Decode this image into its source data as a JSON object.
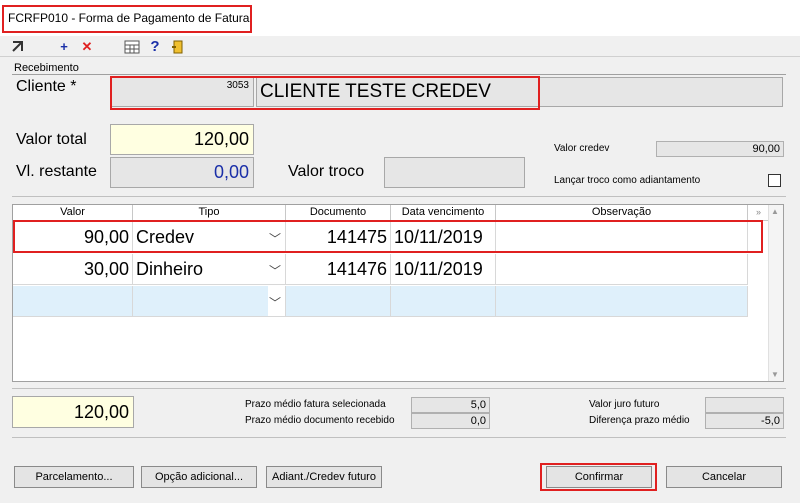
{
  "window": {
    "title": "FCRFP010 - Forma de Pagamento de Fatura"
  },
  "toolbar": {
    "icons": [
      "arrow-icon",
      "add-icon",
      "delete-icon",
      "calculator-icon",
      "help-icon",
      "exit-icon"
    ],
    "add_glyph": "+",
    "delete_glyph": "✕",
    "help_glyph": "?"
  },
  "recebimento": {
    "group_label": "Recebimento",
    "cliente_label": "Cliente *",
    "cliente_code": "3053",
    "cliente_name": "CLIENTE TESTE CREDEV",
    "valor_total_label": "Valor total",
    "valor_total": "120,00",
    "vl_restante_label": "Vl. restante",
    "vl_restante": "0,00",
    "valor_troco_label": "Valor troco",
    "valor_troco": "",
    "valor_credev_label": "Valor credev",
    "valor_credev": "90,00",
    "lancar_troco_label": "Lançar troco como adiantamento"
  },
  "grid": {
    "columns": [
      "Valor",
      "Tipo",
      "Documento",
      "Data vencimento",
      "Observação"
    ],
    "rows": [
      {
        "valor": "90,00",
        "tipo": "Credev",
        "documento": "141475",
        "data": "10/11/2019",
        "obs": ""
      },
      {
        "valor": "30,00",
        "tipo": "Dinheiro",
        "documento": "141476",
        "data": "10/11/2019",
        "obs": ""
      }
    ]
  },
  "summary": {
    "total": "120,00",
    "prazo_fatura_label": "Prazo médio fatura selecionada",
    "prazo_fatura": "5,0",
    "prazo_doc_label": "Prazo médio documento recebido",
    "prazo_doc": "0,0",
    "juro_label": "Valor juro futuro",
    "juro": "",
    "diferenca_label": "Diferença prazo médio",
    "diferenca": "-5,0"
  },
  "buttons": {
    "parcelamento": "Parcelamento...",
    "opcao": "Opção adicional...",
    "adiant": "Adiant./Credev futuro",
    "confirmar": "Confirmar",
    "cancelar": "Cancelar"
  },
  "colors": {
    "highlight": "#e02020",
    "new_row": "#dff0fb",
    "yellow_field": "#ffffe1"
  }
}
